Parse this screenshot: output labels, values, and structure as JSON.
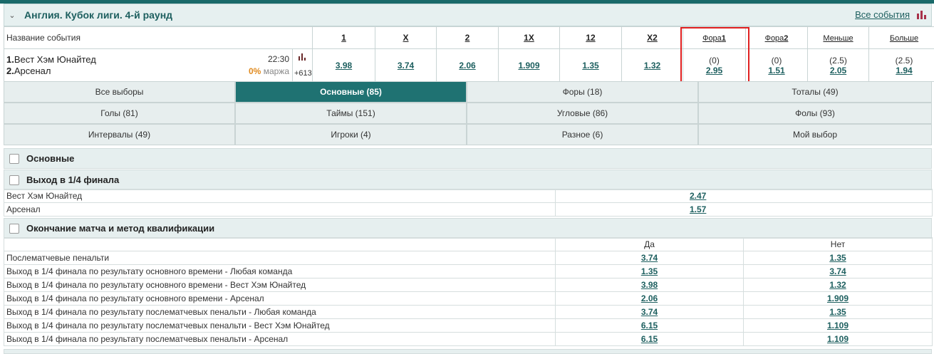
{
  "header": {
    "title": "Англия. Кубок лиги. 4-й раунд",
    "all_events": "Все события"
  },
  "bets_table": {
    "name_header": "Название события",
    "columns": [
      "1",
      "X",
      "2",
      "1X",
      "12",
      "X2"
    ],
    "small_columns": [
      {
        "pre": "Фора",
        "num": "1"
      },
      {
        "pre": "Фора",
        "num": "2"
      },
      {
        "pre": "Меньше",
        "num": ""
      },
      {
        "pre": "Больше",
        "num": ""
      }
    ],
    "event": {
      "team1_num": "1.",
      "team1": "Вест Хэм Юнайтед",
      "team2_num": "2.",
      "team2": "Арсенал",
      "time": "22:30",
      "margin_pct": "0%",
      "margin_label": "маржа",
      "extra_count": "+613"
    },
    "odds": [
      "3.98",
      "3.74",
      "2.06",
      "1.909",
      "1.35",
      "1.32"
    ],
    "handicaps": [
      {
        "param": "(0)",
        "odd": "2.95"
      },
      {
        "param": "(0)",
        "odd": "1.51"
      },
      {
        "param": "(2.5)",
        "odd": "2.05"
      },
      {
        "param": "(2.5)",
        "odd": "1.94"
      }
    ]
  },
  "tabs": [
    {
      "label": "Все выборы"
    },
    {
      "label": "Основные (85)",
      "active": true
    },
    {
      "label": "Форы (18)"
    },
    {
      "label": "Тоталы (49)"
    },
    {
      "label": "Голы (81)"
    },
    {
      "label": "Таймы (151)"
    },
    {
      "label": "Угловые (86)"
    },
    {
      "label": "Фолы (93)"
    },
    {
      "label": "Интервалы (49)"
    },
    {
      "label": "Игроки (4)"
    },
    {
      "label": "Разное (6)"
    },
    {
      "label": "Мой выбор"
    }
  ],
  "sections": {
    "main": {
      "title": "Основные"
    },
    "qualify": {
      "title": "Выход в 1/4 финала",
      "rows": [
        {
          "name": "Вест Хэм Юнайтед",
          "odd": "2.47"
        },
        {
          "name": "Арсенал",
          "odd": "1.57"
        }
      ]
    },
    "method": {
      "title": "Окончание матча и метод квалификации",
      "col_yes": "Да",
      "col_no": "Нет",
      "rows": [
        {
          "name": "Послематчевые пенальти",
          "yes": "3.74",
          "no": "1.35"
        },
        {
          "name": "Выход в 1/4 финала по результату основного времени - Любая команда",
          "yes": "1.35",
          "no": "3.74"
        },
        {
          "name": "Выход в 1/4 финала по результату основного времени - Вест Хэм Юнайтед",
          "yes": "3.98",
          "no": "1.32"
        },
        {
          "name": "Выход в 1/4 финала по результату основного времени - Арсенал",
          "yes": "2.06",
          "no": "1.909"
        },
        {
          "name": "Выход в 1/4 финала по результату послематчевых пенальти - Любая команда",
          "yes": "3.74",
          "no": "1.35"
        },
        {
          "name": "Выход в 1/4 финала по результату послематчевых пенальти - Вест Хэм Юнайтед",
          "yes": "6.15",
          "no": "1.109"
        },
        {
          "name": "Выход в 1/4 финала по результату послематчевых пенальти - Арсенал",
          "yes": "6.15",
          "no": "1.109"
        }
      ]
    }
  },
  "colors": {
    "accent": "#1f7272",
    "highlight": "#e02020",
    "margin": "#e08a1e"
  }
}
